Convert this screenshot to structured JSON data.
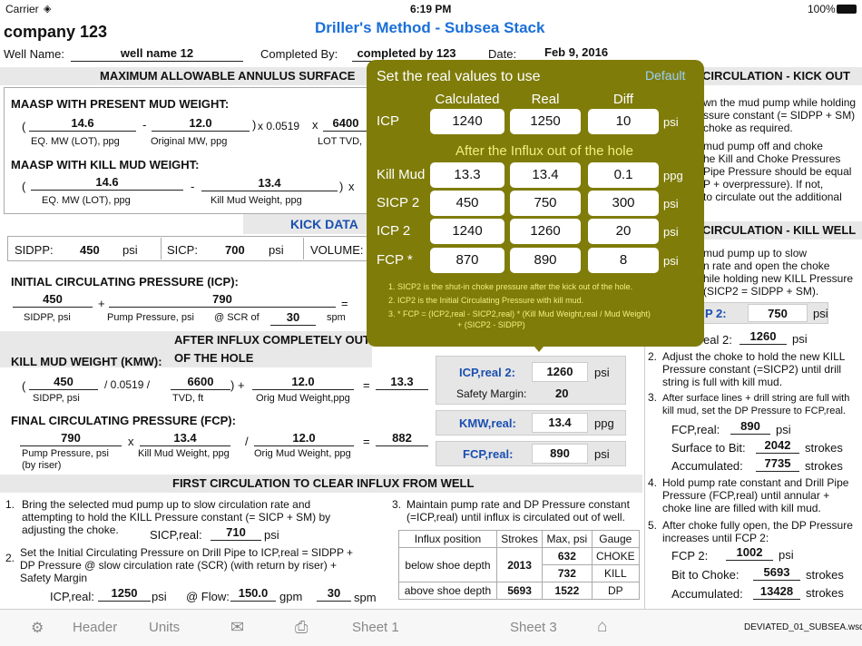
{
  "status": {
    "carrier": "Carrier",
    "time": "6:19 PM",
    "battery": "100%"
  },
  "header": {
    "company": "company 123",
    "title": "Driller's Method - Subsea Stack",
    "well_label": "Well Name:",
    "well_value": "well name 12",
    "completed_label": "Completed By:",
    "completed_value": "completed by 123",
    "date_label": "Date:",
    "date_value": "Feb 9, 2016"
  },
  "maasp": {
    "band": "MAXIMUM ALLOWABLE ANNULUS SURFACE",
    "present_title": "MAASP WITH PRESENT MUD WEIGHT:",
    "eq_mw": "14.6",
    "orig_mw": "12.0",
    "factor": "x 0.0519",
    "lot_tvd": "6400",
    "eq_label": "EQ. MW (LOT), ppg",
    "orig_label": "Original MW,  ppg",
    "lot_label": "LOT TVD,",
    "kill_title": "MAASP WITH KILL MUD WEIGHT:",
    "kill_eq_mw": "14.6",
    "kill_mw": "13.4",
    "kill_eq_label": "EQ. MW (LOT),   ppg",
    "kill_mw_label": "Kill Mud Weight,   ppg"
  },
  "kick": {
    "title": "KICK DATA",
    "sidpp_label": "SIDPP:",
    "sidpp": "450",
    "sidpp_unit": "psi",
    "sicp_label": "SICP:",
    "sicp": "700",
    "sicp_unit": "psi",
    "volume_label": "VOLUME:"
  },
  "icp": {
    "title": "INITIAL CIRCULATING PRESSURE (ICP):",
    "sidpp": "450",
    "pump": "790",
    "sidpp_label": "SIDPP, psi",
    "pump_label": "Pump Pressure,  psi",
    "scr_label": "@ SCR of",
    "scr": "30",
    "scr_unit": "spm"
  },
  "after_band": "AFTER INFLUX COMPLETELY OUT OF THE HOLE",
  "kmw": {
    "title": "KILL MUD WEIGHT (KMW):",
    "sidpp": "450",
    "factor": "/ 0.0519 /",
    "tvd": "6600",
    "orig": "12.0",
    "result": "13.3",
    "sidpp_label": "SIDPP, psi",
    "tvd_label": "TVD,  ft",
    "orig_label": "Orig Mud Weight,ppg"
  },
  "fcp": {
    "title": "FINAL CIRCULATING PRESSURE (FCP):",
    "pump": "790",
    "kmw": "13.4",
    "orig": "12.0",
    "result": "882",
    "pump_label": "Pump Pressure, psi",
    "riser_label": "(by riser)",
    "kmw_label": "Kill Mud Weight, ppg",
    "orig_label": "Orig Mud Weight, ppg"
  },
  "real_boxes": {
    "icp_label": "ICP,real 2:",
    "icp_value": "1260",
    "icp_unit": "psi",
    "sm_label": "Safety Margin:",
    "sm_value": "20",
    "kmw_label": "KMW,real:",
    "kmw_value": "13.4",
    "kmw_unit": "ppg",
    "fcp_label": "FCP,real:",
    "fcp_value": "890",
    "fcp_unit": "psi"
  },
  "first": {
    "band": "FIRST CIRCULATION TO CLEAR INFLUX FROM WELL",
    "step1": "Bring the selected mud pump up to slow circulation rate and attempting to hold the KILL Pressure constant  (= SICP + SM) by adjusting the choke.",
    "sicp_label": "SICP,real:",
    "sicp_value": "710",
    "sicp_unit": "psi",
    "step2": "Set the Initial Circulating Pressure on Drill Pipe to ICP,real = SIDPP + DP Pressure @ slow circulation rate (SCR) (with return by riser) + Safety Margin",
    "icp_label": "ICP,real:",
    "icp_value": "1250",
    "icp_unit": "psi",
    "flow_label": "@ Flow:",
    "flow_value": "150.0",
    "flow_unit": "gpm",
    "spm_value": "30",
    "spm_unit": "spm",
    "step3": "Maintain pump rate and DP Pressure constant (=ICP,real) until influx is circulated out of well."
  },
  "influx_table": {
    "headers": [
      "Influx position",
      "Strokes",
      "Max, psi",
      "Gauge"
    ],
    "below_label": "below shoe depth",
    "below_strokes": "2013",
    "below_choke_psi": "632",
    "below_choke": "CHOKE",
    "below_kill_psi": "732",
    "below_kill": "KILL",
    "above_label": "above shoe depth",
    "above_strokes": "5693",
    "above_psi": "1522",
    "above_gauge": "DP"
  },
  "right": {
    "kick_band": "CIRCULATION - KICK OUT",
    "kick_text1": "wn the mud pump while holding",
    "kick_text2": "ssure constant (= SIDPP + SM)",
    "kick_text3": "choke as required.",
    "kick_text4": "mud pump off and choke",
    "kick_text5": "he Kill and Choke Pressures",
    "kick_text6": "Pipe Pressure should be equal",
    "kick_text7": "P + overpressure). If not,",
    "kick_text8": "to circulate out the additional",
    "kill_band": "CIRCULATION - KILL WELL",
    "kill_text1": "mud pump up to slow",
    "kill_text2": "n rate and open the choke",
    "kill_text3": "hile holding new KILL Pressure",
    "kill_text4": "(SICP2 = SIDPP + SM).",
    "p2_label": "P 2:",
    "p2_value": "750",
    "p2_unit": "psi",
    "re2_label": "eal 2:",
    "re2_value": "1260",
    "re2_unit": "psi",
    "step2": "Adjust the choke to hold the new KILL Pressure constant (=SICP2) until drill string is full with kill mud.",
    "step3": "After surface lines + drill string are full with kill mud, set the DP Pressure to FCP,real.",
    "fcp_label": "FCP,real:",
    "fcp_value": "890",
    "fcp_unit": "psi",
    "surf_label": "Surface to Bit:",
    "surf_value": "2042",
    "surf_unit": "strokes",
    "acc_label": "Accumulated:",
    "acc_value": "7735",
    "acc_unit": "strokes",
    "step4": "Hold pump rate constant and Drill Pipe Pressure (FCP,real) until annular + choke line are filled with kill mud.",
    "step5": "After choke fully open, the DP Pressure increases until FCP 2:",
    "fcp2_label": "FCP 2:",
    "fcp2_value": "1002",
    "fcp2_unit": "psi",
    "btc_label": "Bit to Choke:",
    "btc_value": "5693",
    "btc_unit": "strokes",
    "acc2_label": "Accumulated:",
    "acc2_value": "13428",
    "acc2_unit": "strokes"
  },
  "popup": {
    "title": "Set the real values to use",
    "default": "Default",
    "col_calc": "Calculated",
    "col_real": "Real",
    "col_diff": "Diff",
    "icp_label": "ICP",
    "icp_calc": "1240",
    "icp_real": "1250",
    "icp_diff": "10",
    "icp_unit": "psi",
    "subtitle": "After the Influx out of the hole",
    "kill_label": "Kill Mud",
    "kill_calc": "13.3",
    "kill_real": "13.4",
    "kill_diff": "0.1",
    "kill_unit": "ppg",
    "sicp_label": "SICP 2",
    "sicp_calc": "450",
    "sicp_real": "750",
    "sicp_diff": "300",
    "sicp_unit": "psi",
    "icp2_label": "ICP 2",
    "icp2_calc": "1240",
    "icp2_real": "1260",
    "icp2_diff": "20",
    "icp2_unit": "psi",
    "fcp_label": "FCP *",
    "fcp_calc": "870",
    "fcp_real": "890",
    "fcp_diff": "8",
    "fcp_unit": "psi",
    "note1": "1. SICP2 is the shut-in choke pressure after the kick out of the hole.",
    "note2": "2. ICP2 is the Initial Circulating Pressure with kill mud.",
    "note3": "3. * FCP = (ICP2,real - SICP2,real) * (Kill Mud Weight,real / Mud Weight)",
    "note4": "+ (SICP2 - SIDPP)"
  },
  "tabbar": {
    "header": "Header",
    "units": "Units",
    "sheet1": "Sheet 1",
    "sheet3": "Sheet 3",
    "file": "DEVIATED_01_SUBSEA.wsdf"
  }
}
